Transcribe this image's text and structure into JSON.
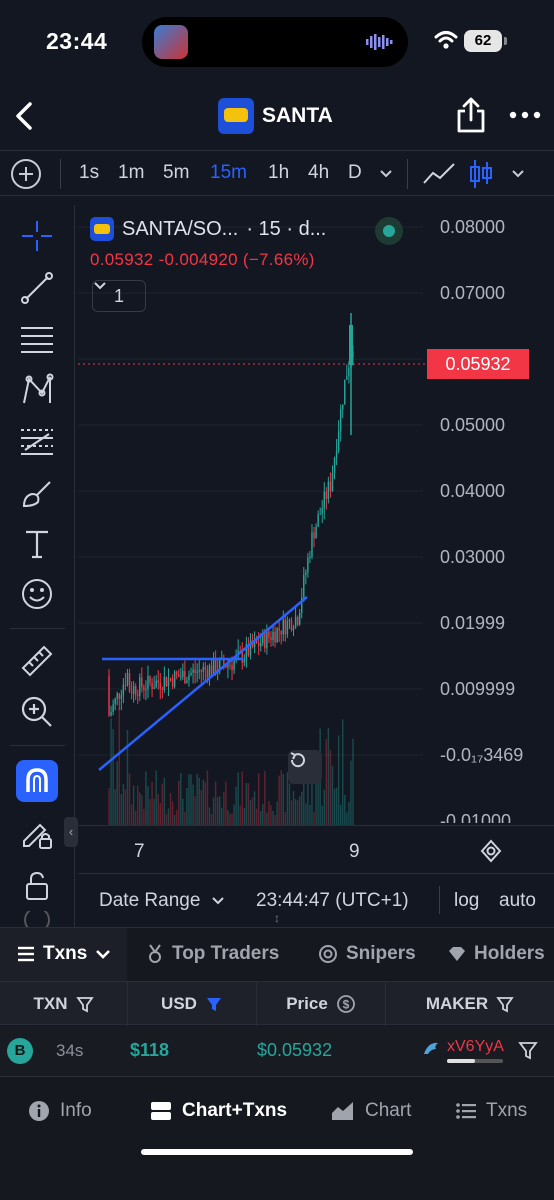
{
  "status_bar": {
    "time": "23:44",
    "battery": "62"
  },
  "header": {
    "title": "SANTA"
  },
  "toolbar": {
    "intervals": [
      "1s",
      "1m",
      "5m",
      "15m",
      "1h",
      "4h",
      "D"
    ],
    "active_interval": "15m"
  },
  "chart": {
    "symbol": "SANTA/SO...",
    "meta": "· 15 · d...",
    "ohlc_text": "0.05932  -0.004920 (−7.66%)",
    "collapse_count": "1",
    "last_price": "0.05932",
    "price_ticks": [
      "0.08000",
      "0.07000",
      "0.05000",
      "0.04000",
      "0.03000",
      "0.01999",
      "0.009999",
      "-0.0₁₇3469",
      "-0.01000"
    ],
    "time_ticks": [
      "7",
      "9"
    ],
    "colors": {
      "up": "#26a69a",
      "down": "#f23645",
      "drawing": "#2962ff",
      "accent": "#2962ff"
    }
  },
  "chart_bar": {
    "date_range": "Date Range",
    "clock": "23:44:47 (UTC+1)",
    "log": "log",
    "auto": "auto"
  },
  "tabs": [
    "Txns",
    "Top Traders",
    "Snipers",
    "Holders"
  ],
  "table": {
    "headers": {
      "txn": "TXN",
      "usd": "USD",
      "price": "Price",
      "maker": "MAKER"
    },
    "rows": [
      {
        "type": "B",
        "age": "34s",
        "usd": "$118",
        "price": "$0.05932",
        "maker": "xV6YyA"
      }
    ]
  },
  "bottom_nav": [
    "Info",
    "Chart+Txns",
    "Chart",
    "Txns"
  ],
  "left_tools": [
    "crosshair-icon",
    "trend-line-icon",
    "fib-lines-icon",
    "pattern-icon",
    "projection-icon",
    "brush-icon",
    "text-icon",
    "emoji-icon",
    "ruler-icon",
    "zoom-in-icon",
    "magnet-icon",
    "lock-pencil-icon",
    "lock-icon"
  ]
}
